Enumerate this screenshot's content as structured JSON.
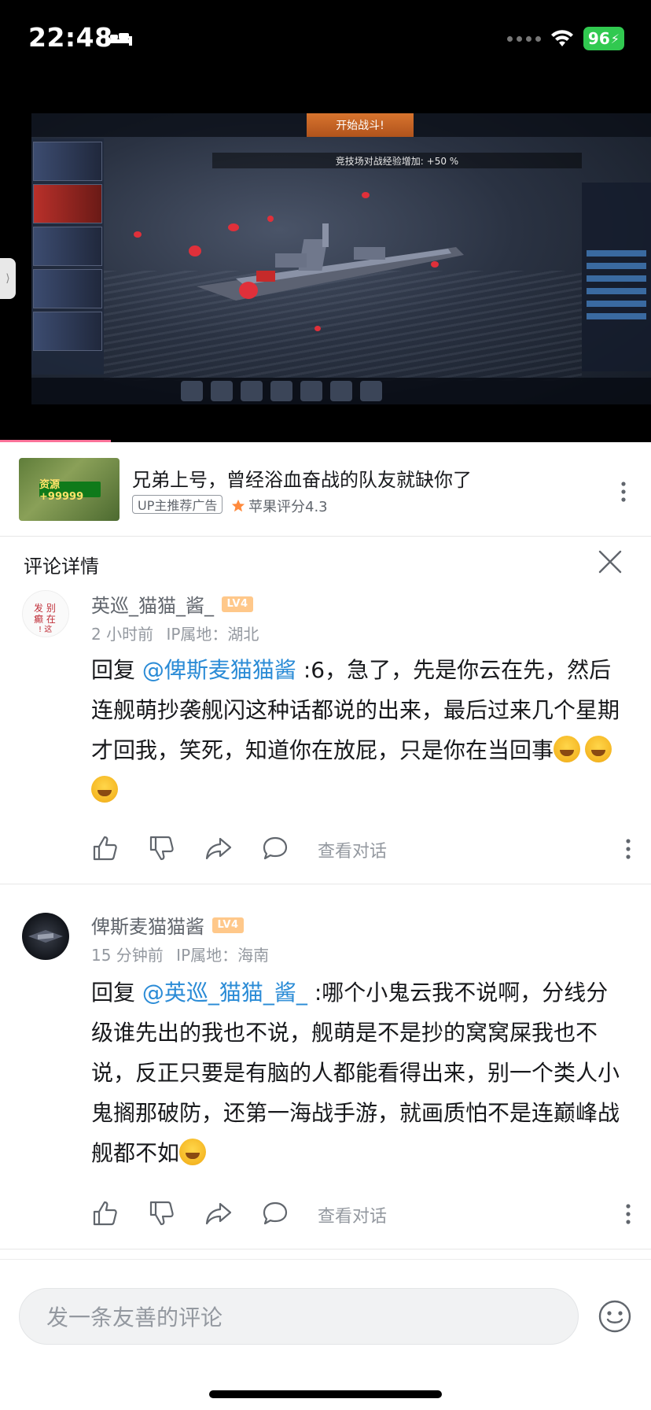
{
  "status_bar": {
    "time": "22:48",
    "battery": "96"
  },
  "video": {
    "progress_fraction": 0.17,
    "banner_text": "竞技场对战经验增加: +50 %",
    "start_button": "开始战斗!"
  },
  "ad": {
    "thumb_badge": "资源+99999",
    "title": "兄弟上号，曾经浴血奋战的队友就缺你了",
    "tag": "UP主推荐广告",
    "rating": "苹果评分4.3"
  },
  "comment_header": {
    "title": "评论详情"
  },
  "comments": [
    {
      "user": "英巡_猫猫_酱_",
      "level": "LV4",
      "time": "2 小时前",
      "ip": "IP属地：湖北",
      "reply_prefix": "回复 ",
      "mention": "@俾斯麦猫猫酱",
      "text": " :6，急了，先是你云在先，然后连舰萌抄袭舰闪这种话都说的出来，最后过来几个星期才回我，笑死，知道你在放屁，只是你在当回事",
      "view_dialog": "查看对话"
    },
    {
      "user": "俾斯麦猫猫酱",
      "level": "LV4",
      "time": "15 分钟前",
      "ip": "IP属地：海南",
      "reply_prefix": "回复 ",
      "mention": "@英巡_猫猫_酱_",
      "text": " :哪个小鬼云我不说啊，分线分级谁先出的我也不说，舰萌是不是抄的窝窝屎我也不说，反正只要是有脑的人都能看得出来，别一个类人小鬼搁那破防，还第一海战手游，就画质怕不是连巅峰战舰都不如",
      "view_dialog": "查看对话"
    }
  ],
  "input": {
    "placeholder": "发一条友善的评论"
  },
  "colors": {
    "accent_pink": "#fb7299",
    "mention_blue": "#2a8bd6",
    "level_badge": "#ffc88a"
  }
}
